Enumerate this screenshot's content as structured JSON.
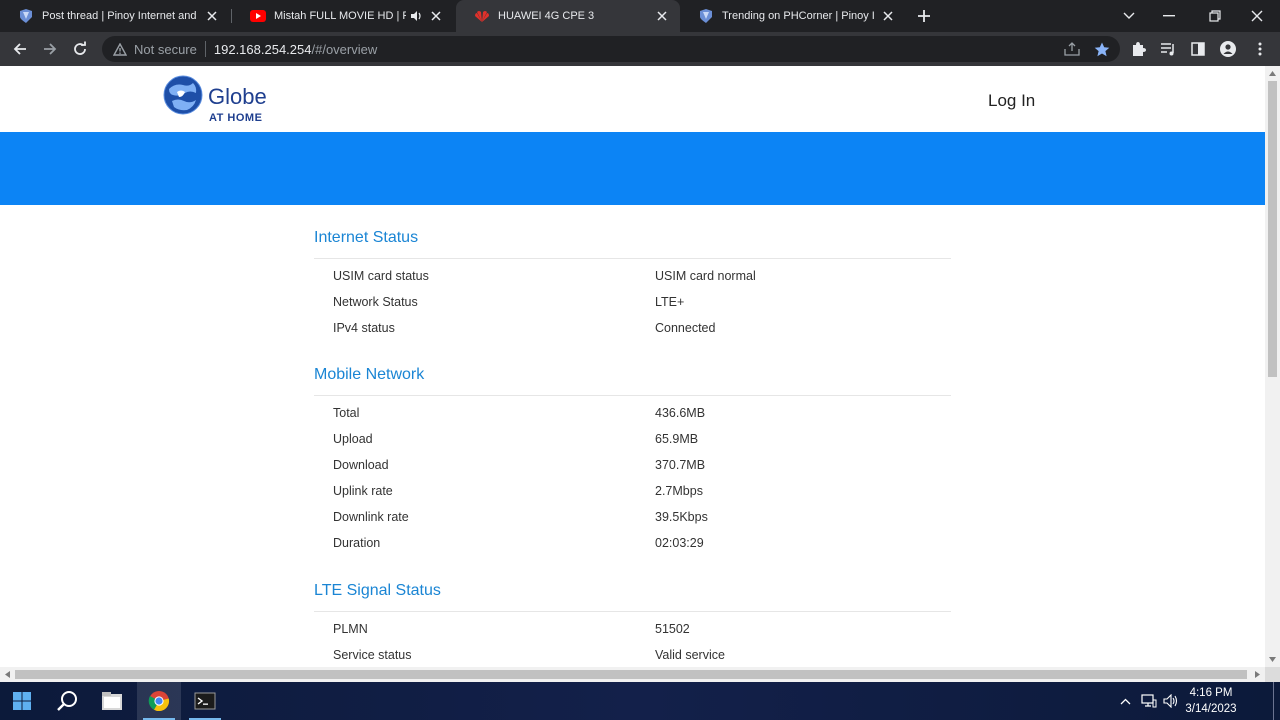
{
  "browser": {
    "tabs": [
      {
        "title": "Post thread | Pinoy Internet and T",
        "favicon": "phcorner-icon",
        "active": false,
        "audio": false
      },
      {
        "title": "Mistah FULL MOVIE HD | Rob",
        "favicon": "youtube-icon",
        "active": false,
        "audio": true
      },
      {
        "title": "HUAWEI 4G CPE 3",
        "favicon": "huawei-icon",
        "active": true,
        "audio": false
      },
      {
        "title": "Trending on PHCorner | Pinoy Int",
        "favicon": "phcorner-icon",
        "active": false,
        "audio": false
      }
    ],
    "security_label": "Not secure",
    "url_host": "192.168.254.254",
    "url_path": "/#/overview"
  },
  "page": {
    "logo_text": "Globe",
    "logo_subtext": "AT HOME",
    "login_label": "Log In",
    "banner_color": "#0c84f5",
    "accent_color": "#1a85d4",
    "sections": [
      {
        "title": "Internet Status",
        "rows": [
          {
            "label": "USIM card status",
            "value": "USIM card normal"
          },
          {
            "label": "Network Status",
            "value": "LTE+"
          },
          {
            "label": "IPv4 status",
            "value": "Connected"
          }
        ]
      },
      {
        "title": "Mobile Network",
        "rows": [
          {
            "label": "Total",
            "value": "436.6MB"
          },
          {
            "label": "Upload",
            "value": "65.9MB"
          },
          {
            "label": "Download",
            "value": "370.7MB"
          },
          {
            "label": "Uplink rate",
            "value": "2.7Mbps"
          },
          {
            "label": "Downlink rate",
            "value": "39.5Kbps"
          },
          {
            "label": "Duration",
            "value": "02:03:29"
          }
        ]
      },
      {
        "title": "LTE Signal Status",
        "rows": [
          {
            "label": "PLMN",
            "value": "51502"
          },
          {
            "label": "Service status",
            "value": "Valid service"
          }
        ]
      }
    ]
  },
  "taskbar": {
    "time": "4:16 PM",
    "date": "3/14/2023"
  }
}
